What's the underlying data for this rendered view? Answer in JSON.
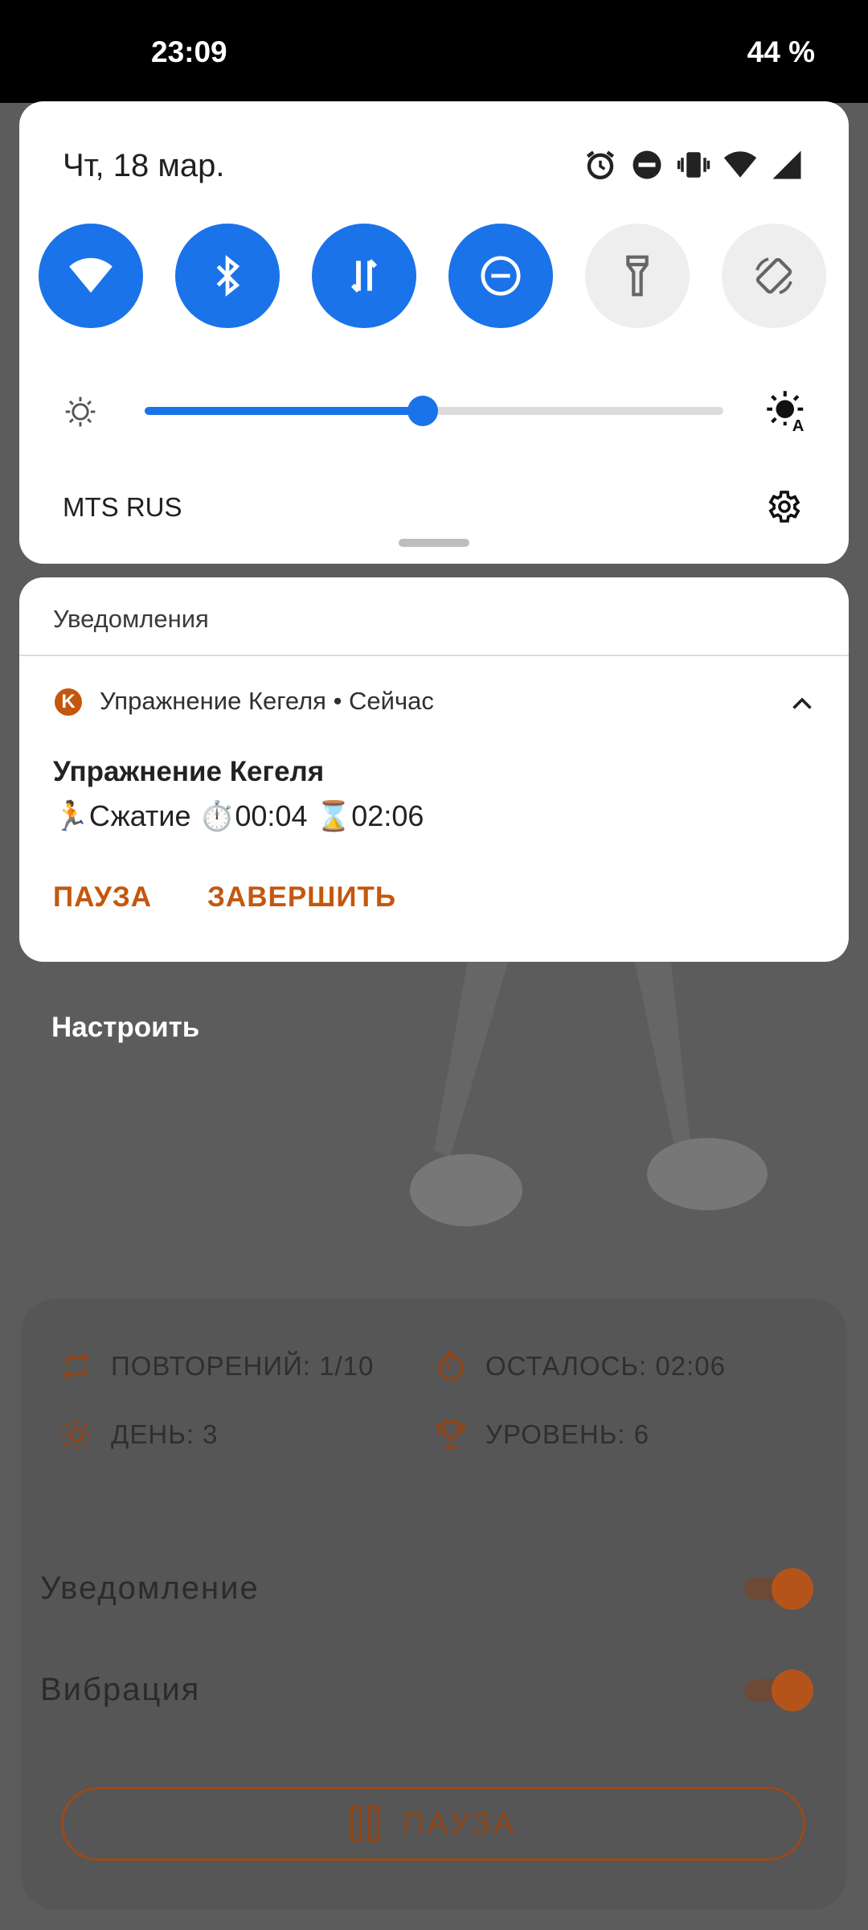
{
  "status_bar": {
    "time": "23:09",
    "battery": "44 %"
  },
  "quick_settings": {
    "date": "Чт, 18 мар.",
    "brightness_level": 0.48,
    "carrier": "MTS RUS",
    "tiles": [
      {
        "name": "wifi",
        "on": true
      },
      {
        "name": "bluetooth",
        "on": true
      },
      {
        "name": "mobile-data",
        "on": true
      },
      {
        "name": "do-not-disturb",
        "on": true
      },
      {
        "name": "flashlight",
        "on": false
      },
      {
        "name": "auto-rotate",
        "on": false
      }
    ]
  },
  "notifications": {
    "header": "Уведомления",
    "app_icon_letter": "K",
    "app_line": "Упражнение Кегеля • Сейчас",
    "title": "Упражнение Кегеля",
    "text": "🏃Сжатие ⏱️00:04 ⌛02:06",
    "actions": [
      "ПАУЗА",
      "ЗАВЕРШИТЬ"
    ]
  },
  "customize_label": "Настроить",
  "background_app": {
    "stats": {
      "repeats": "ПОВТОРЕНИЙ: 1/10",
      "remaining": "ОСТАЛОСЬ: 02:06",
      "day": "ДЕНЬ: 3",
      "level": "УРОВЕНЬ: 6"
    },
    "toggles": [
      {
        "label": "Уведомление",
        "on": true
      },
      {
        "label": "Вибрация",
        "on": true
      }
    ],
    "pause_button": "ПАУЗА"
  },
  "colors": {
    "accent": "#1a73e8",
    "app_accent": "#c4570f"
  }
}
